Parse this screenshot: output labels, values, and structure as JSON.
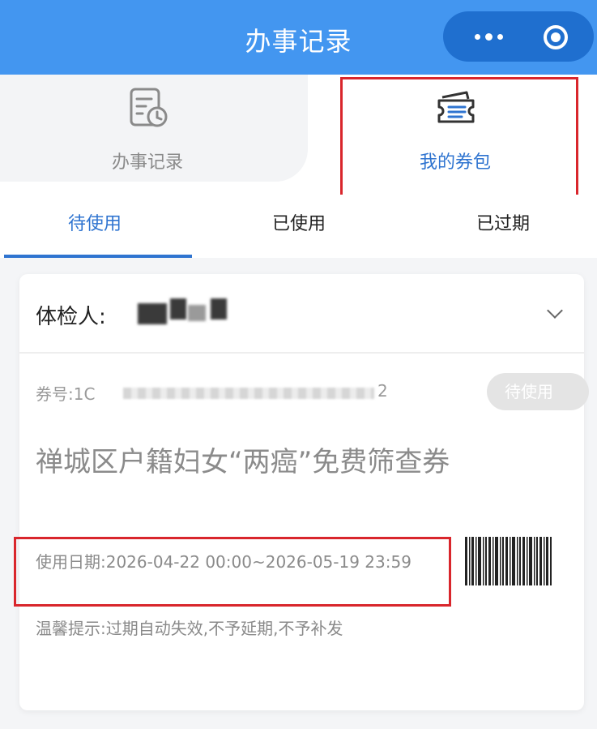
{
  "header": {
    "title": "办事记录"
  },
  "top_tabs": [
    {
      "label": "办事记录",
      "icon": "record-clock-icon",
      "selected": false
    },
    {
      "label": "我的券包",
      "icon": "coupon-wallet-icon",
      "selected": true
    }
  ],
  "status_tabs": [
    {
      "label": "待使用",
      "active": true
    },
    {
      "label": "已使用",
      "active": false
    },
    {
      "label": "已过期",
      "active": false
    }
  ],
  "card": {
    "examinee_label": "体检人:",
    "coupon_no_label": "券号:1C",
    "coupon_no_tail": "2",
    "status_badge": "待使用",
    "title": "禅城区户籍妇女“两癌”免费筛查券",
    "use_date": "使用日期:2026-04-22 00:00~2026-05-19 23:59",
    "tip": "温馨提示:过期自动失效,不予延期,不予补发"
  },
  "colors": {
    "header_bg": "#4396f0",
    "accent": "#2f74d0",
    "highlight_box": "#d9262c",
    "badge_bg": "#e4e4e4"
  }
}
